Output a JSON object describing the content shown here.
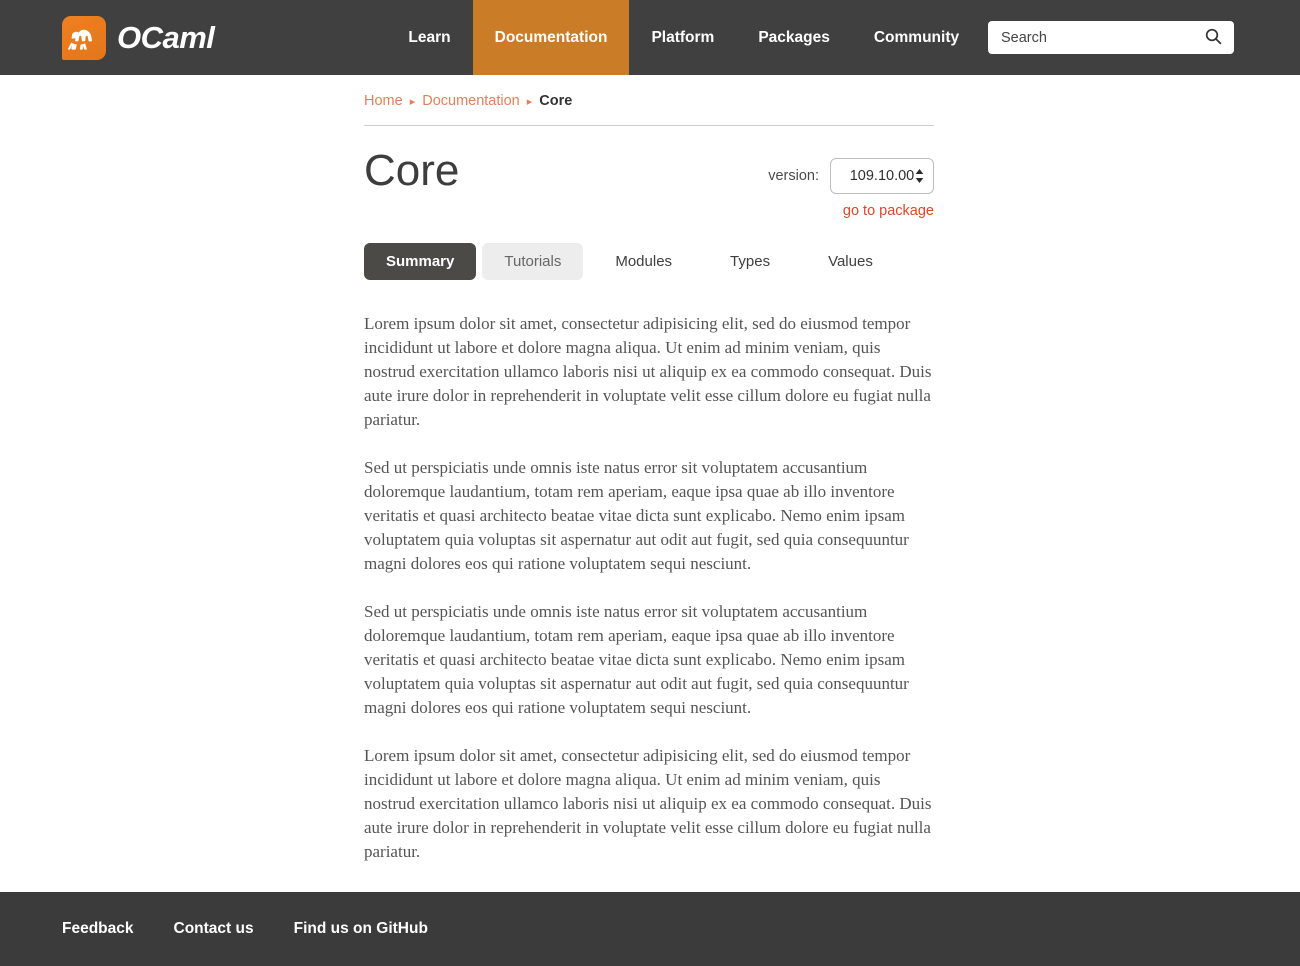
{
  "header": {
    "brand_name": "OCaml",
    "logo_icon": "ocaml-camel-logo",
    "nav": [
      {
        "label": "Learn",
        "active": false
      },
      {
        "label": "Documentation",
        "active": true
      },
      {
        "label": "Platform",
        "active": false
      },
      {
        "label": "Packages",
        "active": false
      },
      {
        "label": "Community",
        "active": false
      }
    ],
    "search": {
      "placeholder": "Search",
      "value": "",
      "icon": "search-icon"
    }
  },
  "breadcrumb": {
    "items": [
      {
        "label": "Home",
        "current": false
      },
      {
        "label": "Documentation",
        "current": false
      },
      {
        "label": "Core",
        "current": true
      }
    ],
    "separator": "▸"
  },
  "main": {
    "title": "Core",
    "version": {
      "label": "version:",
      "selected": "109.10.00",
      "options": [
        "109.10.00"
      ],
      "goto_package_label": "go to package"
    },
    "tabs": [
      {
        "label": "Summary",
        "state": "active"
      },
      {
        "label": "Tutorials",
        "state": "hover"
      },
      {
        "label": "Modules",
        "state": "plain"
      },
      {
        "label": "Types",
        "state": "plain"
      },
      {
        "label": "Values",
        "state": "plain"
      }
    ],
    "paragraphs": [
      "Lorem ipsum dolor sit amet, consectetur adipisicing elit, sed do eiusmod tempor incididunt ut labore et dolore magna aliqua. Ut enim ad minim veniam, quis nostrud exercitation ullamco laboris nisi ut aliquip ex ea commodo consequat. Duis aute irure dolor in reprehenderit in voluptate velit esse cillum dolore eu fugiat nulla pariatur.",
      "Sed ut perspiciatis unde omnis iste natus error sit voluptatem accusantium doloremque laudantium, totam rem aperiam, eaque ipsa quae ab illo inventore veritatis et quasi architecto beatae vitae dicta sunt explicabo. Nemo enim ipsam voluptatem quia voluptas sit aspernatur aut odit aut fugit, sed quia consequuntur magni dolores eos qui ratione voluptatem sequi nesciunt.",
      "Sed ut perspiciatis unde omnis iste natus error sit voluptatem accusantium doloremque laudantium, totam rem aperiam, eaque ipsa quae ab illo inventore veritatis et quasi architecto beatae vitae dicta sunt explicabo. Nemo enim ipsam voluptatem quia voluptas sit aspernatur aut odit aut fugit, sed quia consequuntur magni dolores eos qui ratione voluptatem sequi nesciunt.",
      "Lorem ipsum dolor sit amet, consectetur adipisicing elit, sed do eiusmod tempor incididunt ut labore et dolore magna aliqua. Ut enim ad minim veniam, quis nostrud exercitation ullamco laboris nisi ut aliquip ex ea commodo consequat. Duis aute irure dolor in reprehenderit in voluptate velit esse cillum dolore eu fugiat nulla pariatur."
    ]
  },
  "footer": {
    "links": [
      "Feedback",
      "Contact us",
      "Find us on GitHub"
    ]
  },
  "colors": {
    "header_bg": "#404040",
    "accent_orange": "#ca7c27",
    "logo_orange": "#f08020",
    "breadcrumb_link": "#e3805b",
    "goto_package": "#d9472b",
    "active_tab_bg": "#4c4a47",
    "footer_bg": "#3b3b3b"
  }
}
